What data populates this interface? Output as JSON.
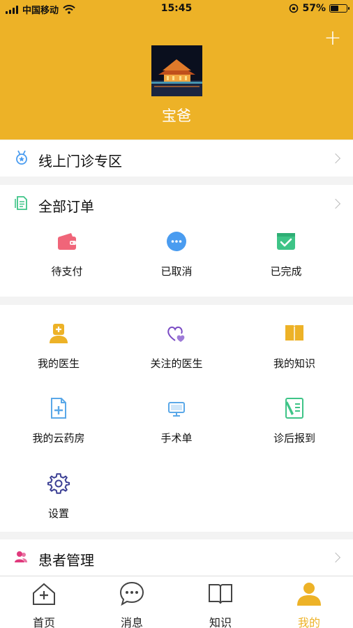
{
  "status_bar": {
    "carrier": "中国移动",
    "time": "15:45",
    "battery": "57%",
    "battery_level": 0.57
  },
  "profile": {
    "name": "宝爸",
    "add_button": "+"
  },
  "online_clinic": {
    "title": "线上门诊专区"
  },
  "orders": {
    "title": "全部订单",
    "items": [
      {
        "label": "待支付",
        "icon": "wallet-icon"
      },
      {
        "label": "已取消",
        "icon": "cancelled-icon"
      },
      {
        "label": "已完成",
        "icon": "completed-icon"
      }
    ]
  },
  "services": {
    "items": [
      {
        "label": "我的医生",
        "icon": "doctor-icon"
      },
      {
        "label": "关注的医生",
        "icon": "followed-doctor-icon"
      },
      {
        "label": "我的知识",
        "icon": "book-icon"
      },
      {
        "label": "我的云药房",
        "icon": "pharmacy-icon"
      },
      {
        "label": "手术单",
        "icon": "monitor-icon"
      },
      {
        "label": "诊后报到",
        "icon": "checkin-icon"
      },
      {
        "label": "设置",
        "icon": "gear-icon"
      }
    ]
  },
  "patients": {
    "title": "患者管理"
  },
  "tabbar": {
    "items": [
      {
        "label": "首页",
        "icon": "home-icon"
      },
      {
        "label": "消息",
        "icon": "message-icon"
      },
      {
        "label": "知识",
        "icon": "book-open-icon"
      },
      {
        "label": "我的",
        "icon": "user-icon",
        "active": true
      }
    ]
  },
  "colors": {
    "accent": "#EDB227",
    "wallet": "#F06579",
    "cancel": "#4A9CF0",
    "done": "#3EC487",
    "doctor": "#EDB227",
    "heart": "#7A4BC4",
    "pharmacy": "#5AA8E8",
    "checkin": "#3EC487",
    "gear": "#3B3F94",
    "patient": "#E0397C"
  }
}
